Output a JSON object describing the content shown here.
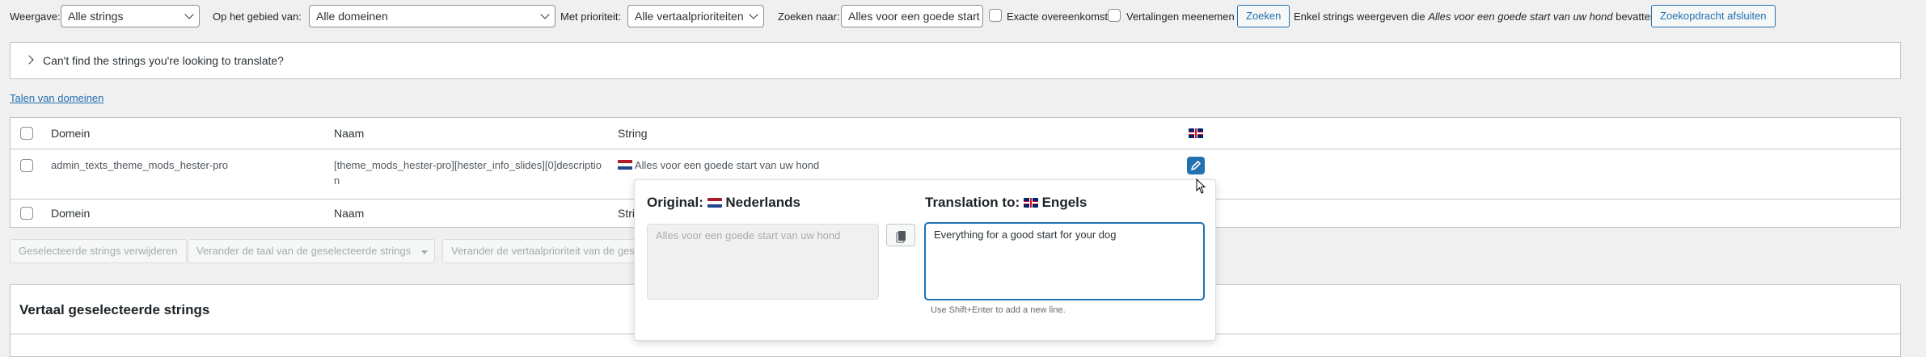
{
  "filters": {
    "show_label": "Weergave:",
    "show_value": "Alle strings",
    "domain_label": "Op het gebied van:",
    "domain_value": "Alle domeinen",
    "priority_label": "Met prioriteit:",
    "priority_value": "Alle vertaalprioriteiten",
    "search_label": "Zoeken naar:",
    "search_value": "Alles voor een goede start",
    "exact_label": "Exacte overeenkomst",
    "include_translations_label": "Vertalingen meenemen",
    "search_button": "Zoeken",
    "result_prefix": "Enkel strings weergeven die",
    "result_term": "Alles voor een goede start van uw hond",
    "result_suffix": "bevatten",
    "close_search_button": "Zoekopdracht afsluiten"
  },
  "notice": {
    "text": "Can't find the strings you're looking to translate?"
  },
  "domain_languages_link": "Talen van domeinen",
  "table": {
    "headers": {
      "domain": "Domein",
      "name": "Naam",
      "string": "String"
    },
    "rows": [
      {
        "domain": "admin_texts_theme_mods_hester-pro",
        "name_line1": "[theme_mods_hester-pro][hester_info_slides][0]descriptio",
        "name_line2": "n",
        "string": "Alles voor een goede start van uw hond"
      }
    ],
    "footer_string_partial": "Stri"
  },
  "bulk": {
    "delete": "Geselecteerde strings verwijderen",
    "change_language": "Verander de taal van de geselecteerde strings",
    "change_priority": "Verander de vertaalprioriteit van de ges"
  },
  "translate_section": {
    "title": "Vertaal geselecteerde strings"
  },
  "popup": {
    "original_label": "Original:",
    "original_lang": "Nederlands",
    "original_text": "Alles voor een goede start van uw hond",
    "translation_label": "Translation to:",
    "translation_lang": "Engels",
    "translation_text": "Everything for a good start for your dog",
    "hint": "Use Shift+Enter to add a new line."
  },
  "colors": {
    "accent": "#2271b1",
    "page_bg": "#f0f0f1"
  }
}
